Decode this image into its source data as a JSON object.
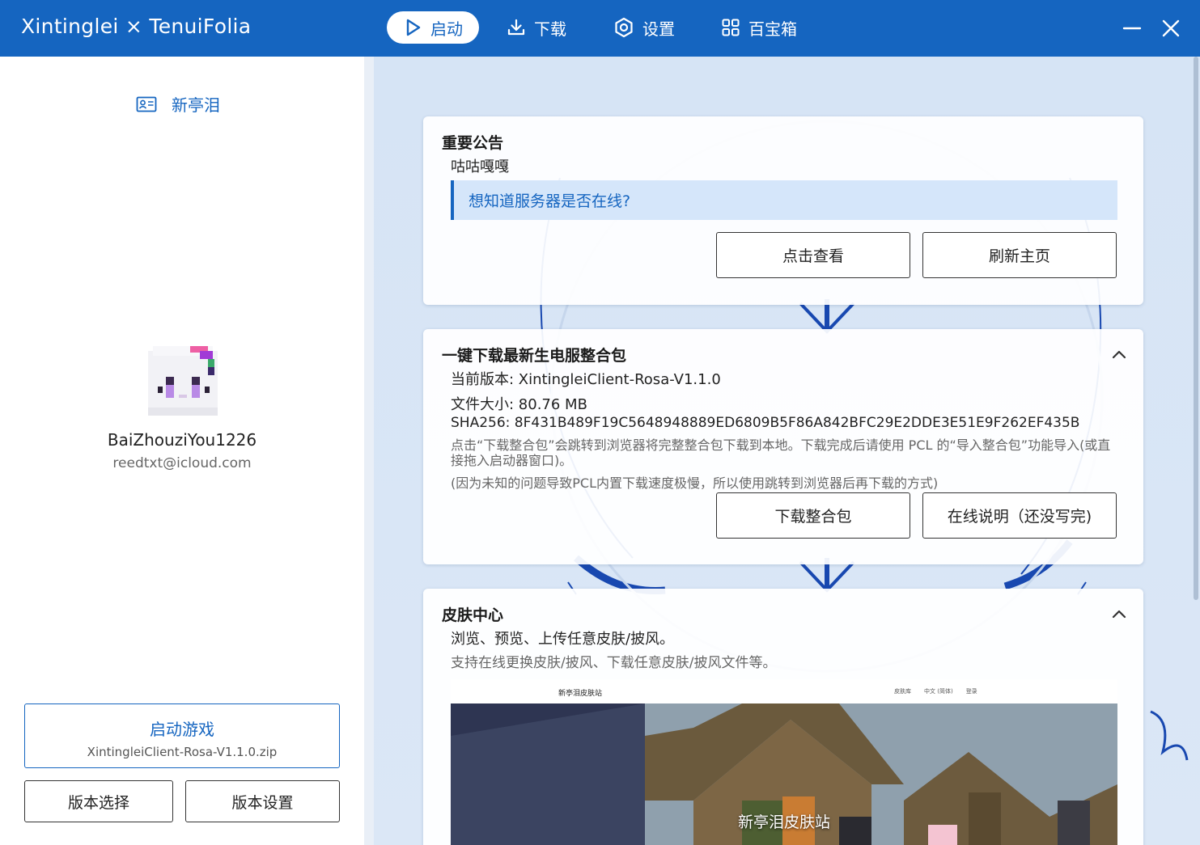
{
  "window": {
    "title": "Xintinglei × TenuiFolia"
  },
  "nav": {
    "tabs": [
      {
        "label": "启动",
        "icon": "play-icon",
        "active": true
      },
      {
        "label": "下载",
        "icon": "download-icon",
        "active": false
      },
      {
        "label": "设置",
        "icon": "gear-icon",
        "active": false
      },
      {
        "label": "百宝箱",
        "icon": "grid-icon",
        "active": false
      }
    ]
  },
  "sidebar": {
    "profile_link": "新亭泪",
    "username": "BaiZhouziYou1226",
    "email": "reedtxt@icloud.com",
    "launch_title": "启动游戏",
    "launch_version": "XintingleiClient-Rosa-V1.1.0.zip",
    "version_select": "版本选择",
    "version_settings": "版本设置"
  },
  "cards": {
    "notice": {
      "title": "重要公告",
      "subtitle": "咕咕嘎嘎",
      "info": "想知道服务器是否在线?",
      "btn_view": "点击查看",
      "btn_refresh": "刷新主页"
    },
    "modpack": {
      "title": "一键下载最新生电服整合包",
      "version": "当前版本: XintingleiClient-Rosa-V1.1.0",
      "size": "文件大小: 80.76 MB",
      "sha": "SHA256: 8F431B489F19C5648948889ED6809B5F86A842BFC29E2DDE3E51E9F262EF435B",
      "note1": "点击“下载整合包”会跳转到浏览器将完整整合包下载到本地。下载完成后请使用 PCL 的“导入整合包”功能导入(或直接拖入启动器窗口)。",
      "note2": "(因为未知的问题导致PCL内置下载速度极慢，所以使用跳转到浏览器后再下载的方式)",
      "btn_download": "下载整合包",
      "btn_docs": "在线说明（还没写完)"
    },
    "skin": {
      "title": "皮肤中心",
      "line1": "浏览、预览、上传任意皮肤/披风。",
      "line2": "支持在线更换皮肤/披风、下载任意皮肤/披风文件等。",
      "preview_site": "新亭泪皮肤站",
      "preview_links": [
        "皮肤库",
        "中文 (简体)",
        "登录"
      ],
      "preview_caption": "新亭泪皮肤站"
    }
  },
  "colors": {
    "accent": "#1565c0",
    "info_bg": "#d5e6fa"
  }
}
